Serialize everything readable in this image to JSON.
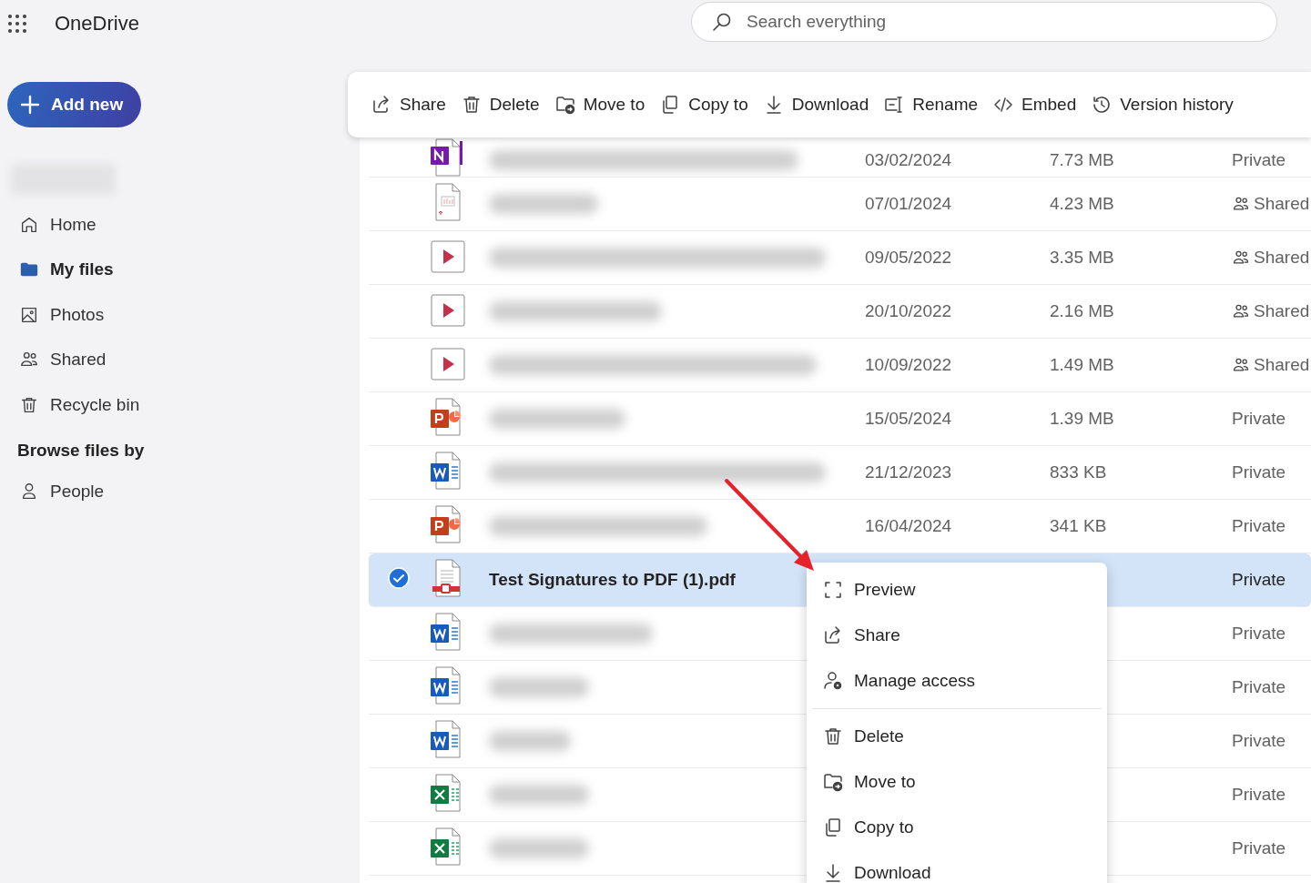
{
  "app": {
    "title": "OneDrive"
  },
  "search": {
    "placeholder": "Search everything"
  },
  "add_button": {
    "label": "Add new"
  },
  "nav": [
    {
      "label": "Home",
      "kind": "home",
      "selected": false
    },
    {
      "label": "My files",
      "kind": "folder",
      "selected": true
    },
    {
      "label": "Photos",
      "kind": "photos",
      "selected": false
    },
    {
      "label": "Shared",
      "kind": "shared",
      "selected": false
    },
    {
      "label": "Recycle bin",
      "kind": "trash",
      "selected": false
    }
  ],
  "browse": {
    "heading": "Browse files by",
    "items": [
      {
        "label": "People",
        "kind": "person",
        "selected": false
      }
    ]
  },
  "toolbar": [
    {
      "label": "Share",
      "kind": "share"
    },
    {
      "label": "Delete",
      "kind": "trash"
    },
    {
      "label": "Move to",
      "kind": "move"
    },
    {
      "label": "Copy to",
      "kind": "copy"
    },
    {
      "label": "Download",
      "kind": "download"
    },
    {
      "label": "Rename",
      "kind": "rename"
    },
    {
      "label": "Embed",
      "kind": "embed"
    },
    {
      "label": "Version history",
      "kind": "history"
    }
  ],
  "rows": [
    {
      "kind": "onenote",
      "selected": false,
      "date": "03/02/2024",
      "size": "7.73 MB",
      "sharing": "Private",
      "shared": false
    },
    {
      "kind": "deck",
      "selected": false,
      "date": "07/01/2024",
      "size": "4.23 MB",
      "sharing": "Shared",
      "shared": true
    },
    {
      "kind": "video",
      "selected": false,
      "date": "09/05/2022",
      "size": "3.35 MB",
      "sharing": "Shared",
      "shared": true
    },
    {
      "kind": "video",
      "selected": false,
      "date": "20/10/2022",
      "size": "2.16 MB",
      "sharing": "Shared",
      "shared": true
    },
    {
      "kind": "video",
      "selected": false,
      "date": "10/09/2022",
      "size": "1.49 MB",
      "sharing": "Shared",
      "shared": true
    },
    {
      "kind": "powerpoint",
      "selected": false,
      "date": "15/05/2024",
      "size": "1.39 MB",
      "sharing": "Private",
      "shared": false
    },
    {
      "kind": "word",
      "selected": false,
      "date": "21/12/2023",
      "size": "833 KB",
      "sharing": "Private",
      "shared": false
    },
    {
      "kind": "powerpoint",
      "selected": false,
      "date": "16/04/2024",
      "size": "341 KB",
      "sharing": "Private",
      "shared": false
    },
    {
      "kind": "pdf",
      "selected": true,
      "name": "Test Signatures to PDF (1).pdf",
      "sharing": "Private",
      "shared": false
    },
    {
      "kind": "word",
      "selected": false,
      "sharing": "Private",
      "shared": false
    },
    {
      "kind": "word",
      "selected": false,
      "sharing": "Private",
      "shared": false
    },
    {
      "kind": "word",
      "selected": false,
      "sharing": "Private",
      "shared": false
    },
    {
      "kind": "excel",
      "selected": false,
      "sharing": "Private",
      "shared": false
    },
    {
      "kind": "excel",
      "selected": false,
      "sharing": "Private",
      "shared": false
    }
  ],
  "context_menu": [
    {
      "label": "Preview",
      "kind": "preview",
      "separator_above": false
    },
    {
      "label": "Share",
      "kind": "share",
      "separator_above": false
    },
    {
      "label": "Manage access",
      "kind": "manage",
      "separator_above": false
    },
    {
      "label": "Delete",
      "kind": "trash",
      "separator_above": true
    },
    {
      "label": "Move to",
      "kind": "move",
      "separator_above": false
    },
    {
      "label": "Copy to",
      "kind": "copy",
      "separator_above": false
    },
    {
      "label": "Download",
      "kind": "download",
      "separator_above": false
    }
  ]
}
